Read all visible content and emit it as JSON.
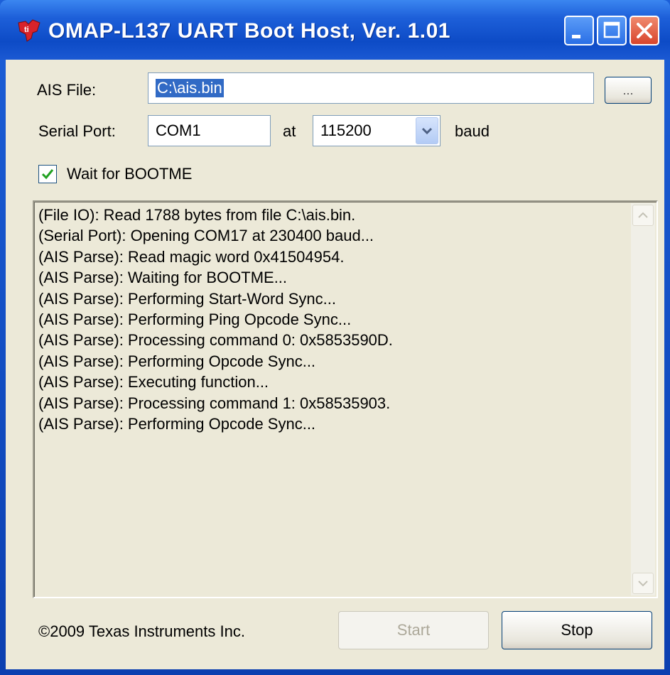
{
  "window": {
    "title": "OMAP-L137 UART Boot Host, Ver. 1.01",
    "logo_icon": "ti-logo-icon",
    "controls": [
      "minimize-icon",
      "maximize-icon",
      "close-icon"
    ]
  },
  "form": {
    "ais_file_label": "AIS File:",
    "ais_file_value": "C:\\ais.bin",
    "browse_label": "...",
    "serial_port_label": "Serial Port:",
    "serial_port_value": "COM1",
    "at_label": "at",
    "baud_value": "115200",
    "baud_label": "baud",
    "wait_bootme_label": "Wait for BOOTME",
    "wait_bootme_checked": true
  },
  "log": {
    "lines": [
      "(File IO): Read 1788 bytes from file C:\\ais.bin.",
      "(Serial Port): Opening COM17 at 230400 baud...",
      "(AIS Parse): Read magic word 0x41504954.",
      "(AIS Parse): Waiting for BOOTME...",
      "(AIS Parse): Performing Start-Word Sync...",
      "(AIS Parse): Performing Ping Opcode Sync...",
      "(AIS Parse): Processing command 0: 0x5853590D.",
      "(AIS Parse): Performing Opcode Sync...",
      "(AIS Parse): Executing function...",
      "(AIS Parse): Processing command 1: 0x58535903.",
      "(AIS Parse): Performing Opcode Sync..."
    ]
  },
  "footer": {
    "copyright": "©2009 Texas Instruments Inc.",
    "start_label": "Start",
    "stop_label": "Stop"
  },
  "colors": {
    "titlebar": "#0d4bc6",
    "client_bg": "#ece9d8",
    "selection": "#316ac5",
    "close_button": "#d8452c",
    "checkbox_check": "#21a121"
  }
}
